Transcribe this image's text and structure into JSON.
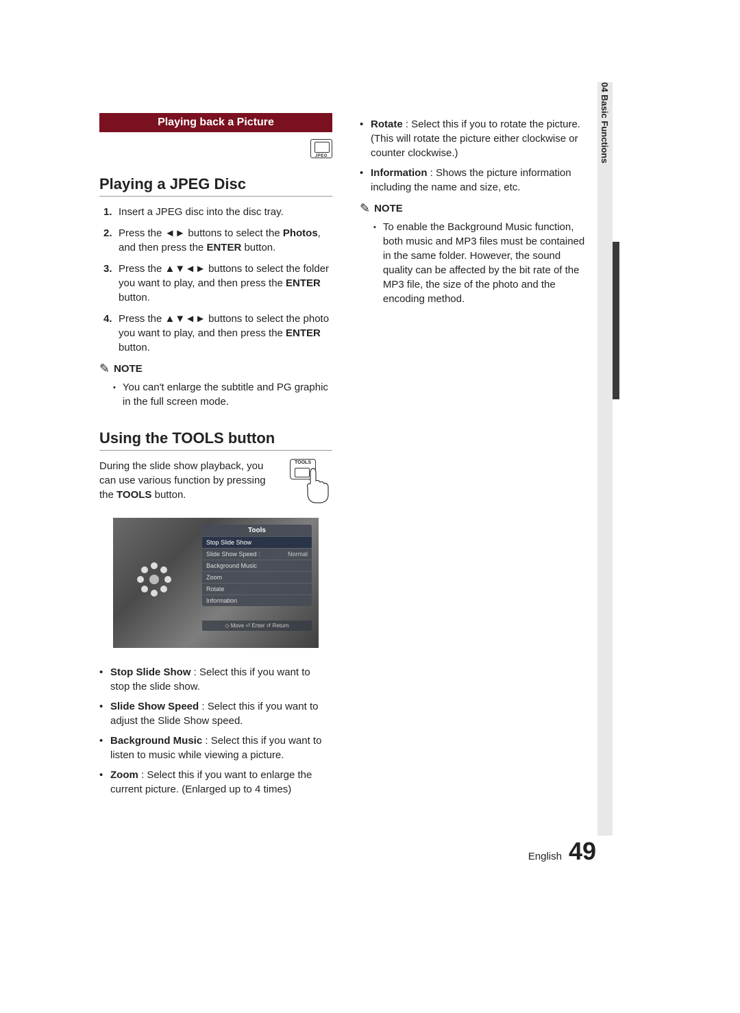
{
  "side_tab": "04  Basic Functions",
  "banner": "Playing back a Picture",
  "h2_jpeg": "Playing a JPEG Disc",
  "steps": [
    {
      "n": "1.",
      "t": "Insert a JPEG disc into the disc tray."
    },
    {
      "n": "2.",
      "t_pre": "Press the ",
      "t_mid": " buttons to select the ",
      "bold1": "Photos",
      "t_post": ", and then press the ",
      "bold2": "ENTER",
      "t_end": " button.",
      "arrows": "◄►"
    },
    {
      "n": "3.",
      "t_pre": "Press the ",
      "arrows": "▲▼◄►",
      "t_mid": " buttons to select the folder you want to play, and then press the ",
      "bold2": "ENTER",
      "t_end": " button."
    },
    {
      "n": "4.",
      "t_pre": "Press the ",
      "arrows": "▲▼◄►",
      "t_mid": " buttons to select the photo you want to play, and then press the ",
      "bold2": "ENTER",
      "t_end": " button."
    }
  ],
  "note_label": "NOTE",
  "note1": "You can't enlarge the subtitle and PG graphic in the full screen mode.",
  "h2_tools": "Using the TOOLS button",
  "tools_intro_pre": "During the slide show playback, you can use various function by pressing the ",
  "tools_intro_bold": "TOOLS",
  "tools_intro_post": " button.",
  "tools_btn_label": "TOOLS",
  "menu": {
    "title": "Tools",
    "items": [
      {
        "label": "Stop Slide Show",
        "selected": true
      },
      {
        "label": "Slide Show Speed  :",
        "value": "Normal"
      },
      {
        "label": "Background Music"
      },
      {
        "label": "Zoom"
      },
      {
        "label": "Rotate"
      },
      {
        "label": "Information"
      }
    ],
    "footer": "◇ Move    ⏎ Enter    ↺ Return"
  },
  "bullets_left": [
    {
      "bold": "Stop Slide Show",
      "rest": " : Select this if you want to stop the slide show."
    },
    {
      "bold": "Slide Show Speed",
      "rest": " : Select this if you want to adjust the Slide Show speed."
    },
    {
      "bold": "Background Music",
      "rest": " : Select this if you want to listen to music while viewing a picture."
    },
    {
      "bold": "Zoom",
      "rest": " : Select this if you want to enlarge the current picture. (Enlarged up to 4 times)"
    }
  ],
  "bullets_right": [
    {
      "bold": "Rotate",
      "rest": " : Select this if you to rotate the picture. (This will rotate the picture either clockwise or counter clockwise.)"
    },
    {
      "bold": "Information",
      "rest": " : Shows the picture information including the name and size, etc."
    }
  ],
  "note2": "To enable the Background Music function, both music and MP3 files must be contained in the same folder. However, the sound quality can be affected by the bit rate of the MP3 file, the size of the photo and the encoding method.",
  "footer_lang": "English",
  "footer_num": "49"
}
